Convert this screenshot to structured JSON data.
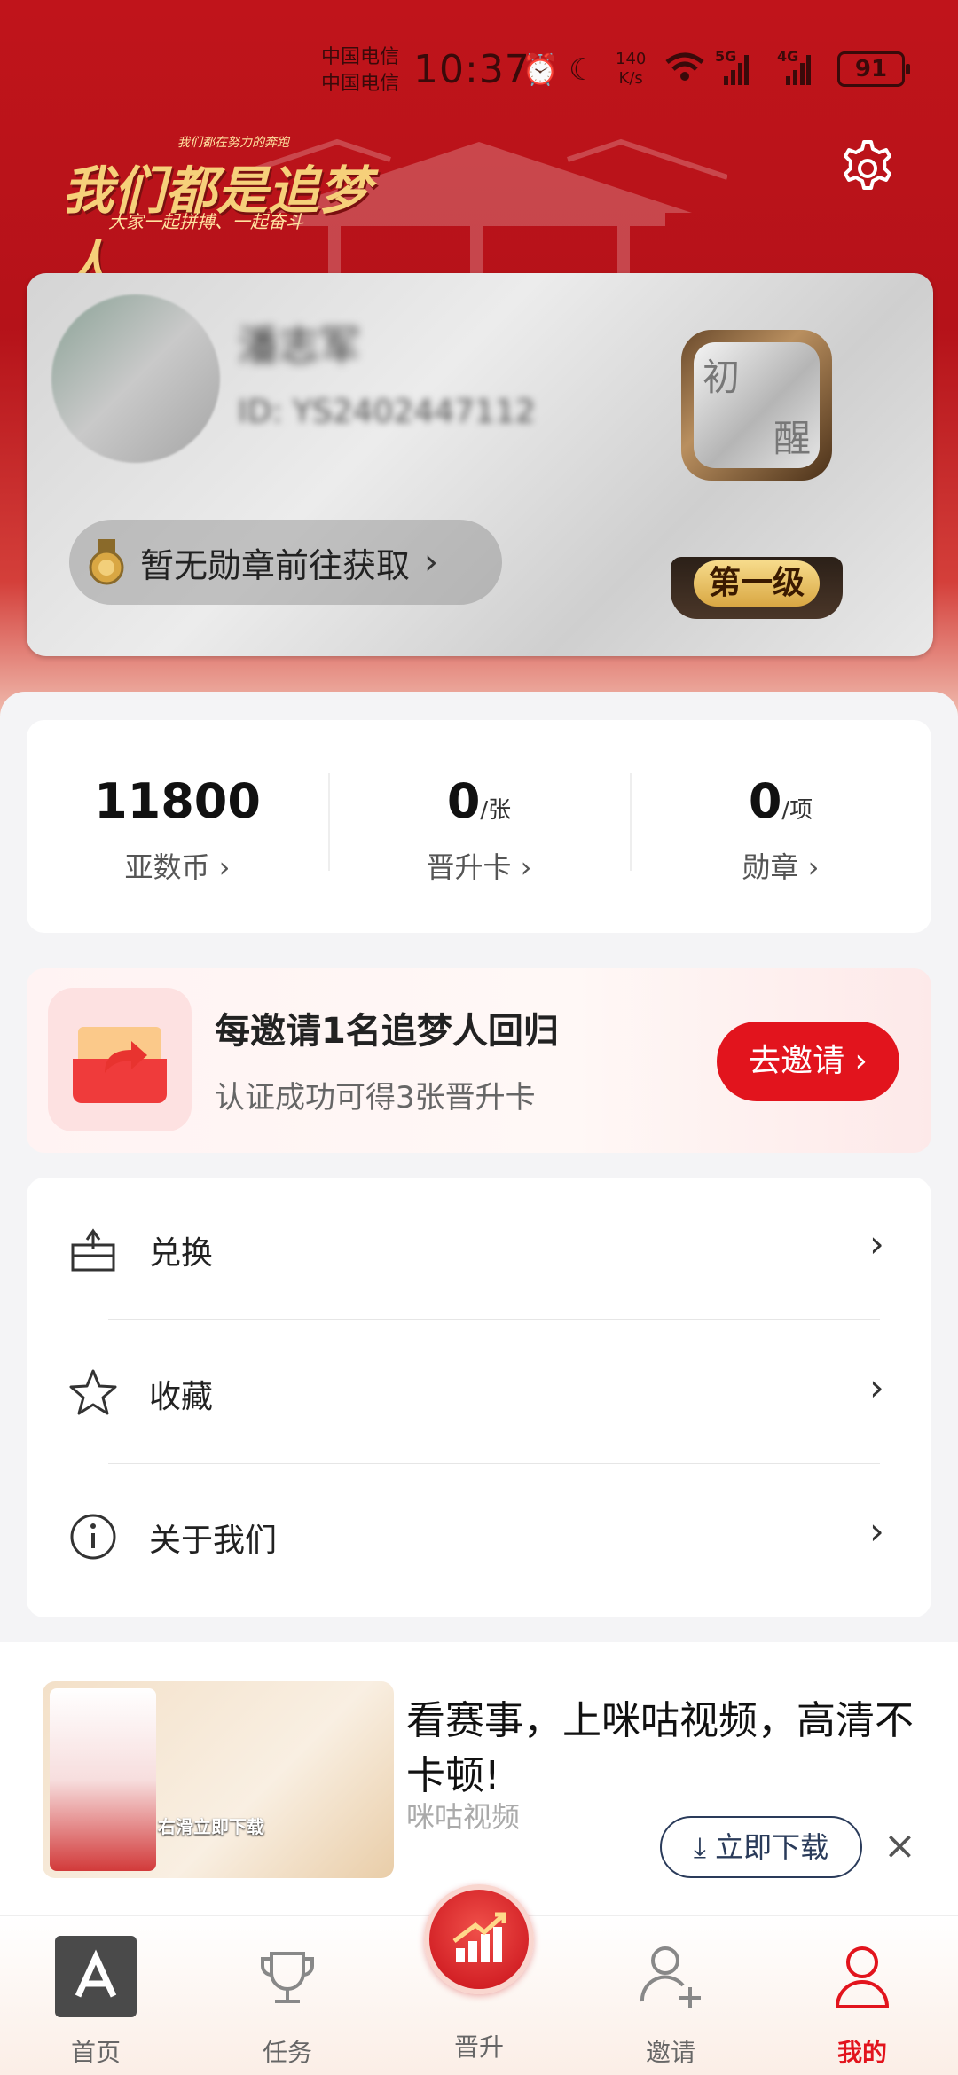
{
  "status_bar": {
    "carrier_1": "中国电信",
    "carrier_2": "中国电信",
    "time": "10:37",
    "speed_value": "140",
    "speed_unit": "K/s",
    "net_5g": "5G",
    "net_4g": "4G",
    "battery": "91"
  },
  "header": {
    "slogan_small": "我们都在努力的奔跑",
    "slogan_main": "我们都是追梦人",
    "slogan_sub": "大家一起拼搏、一起奋斗"
  },
  "profile": {
    "name": "潘志军",
    "id_text": "ID: YS2402447112",
    "medal_text": "暂无勋章前往获取",
    "level_char_1": "初",
    "level_char_2": "醒",
    "level_label": "第一级"
  },
  "stats": [
    {
      "value": "11800",
      "unit": "",
      "label": "亚数币 ›"
    },
    {
      "value": "0",
      "unit": "/张",
      "label": "晋升卡 ›"
    },
    {
      "value": "0",
      "unit": "/项",
      "label": "勋章 ›"
    }
  ],
  "invite": {
    "title": "每邀请1名追梦人回归",
    "subtitle": "认证成功可得3张晋升卡",
    "button": "去邀请 ›"
  },
  "menu": [
    {
      "label": "兑换",
      "icon": "exchange-icon"
    },
    {
      "label": "收藏",
      "icon": "star-icon"
    },
    {
      "label": "关于我们",
      "icon": "info-icon"
    }
  ],
  "ad": {
    "title": "看赛事，上咪咕视频，高清不卡顿!",
    "source": "咪咕视频",
    "button": "立即下载",
    "image_text": "右滑立即下载",
    "close": "×"
  },
  "tabbar": [
    {
      "label": "首页",
      "icon": "home-logo-icon"
    },
    {
      "label": "任务",
      "icon": "trophy-icon"
    },
    {
      "label": "晋升",
      "icon": "growth-chart-icon"
    },
    {
      "label": "邀请",
      "icon": "add-user-icon"
    },
    {
      "label": "我的",
      "icon": "user-icon",
      "active": true
    }
  ],
  "colors": {
    "brand_red": "#e2141d",
    "header_red": "#c0141b",
    "level_gold": "#d9a743"
  }
}
